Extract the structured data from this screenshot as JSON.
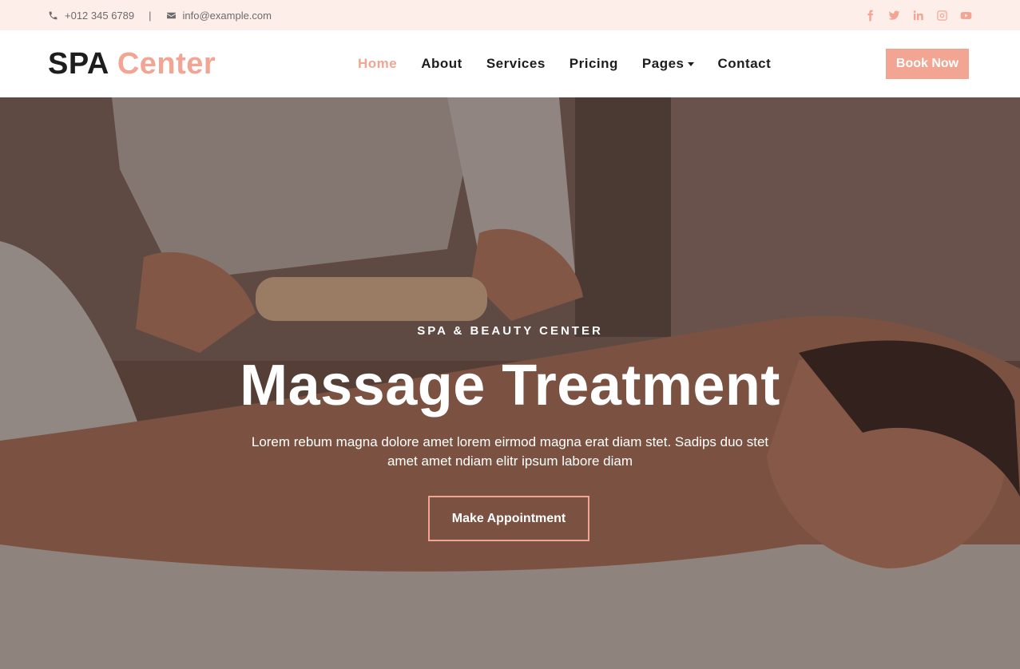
{
  "topbar": {
    "phone": "+012 345 6789",
    "separator": "|",
    "email": "info@example.com",
    "social": [
      "facebook-icon",
      "twitter-icon",
      "linkedin-icon",
      "instagram-icon",
      "youtube-icon"
    ]
  },
  "brand": {
    "part1": "SPA",
    "part2": "Center"
  },
  "nav": {
    "items": [
      {
        "label": "Home"
      },
      {
        "label": "About"
      },
      {
        "label": "Services"
      },
      {
        "label": "Pricing"
      },
      {
        "label": "Pages"
      },
      {
        "label": "Contact"
      }
    ],
    "book_label": "Book Now"
  },
  "hero": {
    "kicker": "SPA & BEAUTY CENTER",
    "title": "Massage Treatment",
    "text": "Lorem rebum magna dolore amet lorem eirmod magna erat diam stet. Sadips duo stet amet amet ndiam elitr ipsum labore diam",
    "button_label": "Make Appointment"
  },
  "colors": {
    "accent": "#f3a593",
    "topbar_bg": "#fdeeea",
    "dark": "#1d1d1d"
  }
}
